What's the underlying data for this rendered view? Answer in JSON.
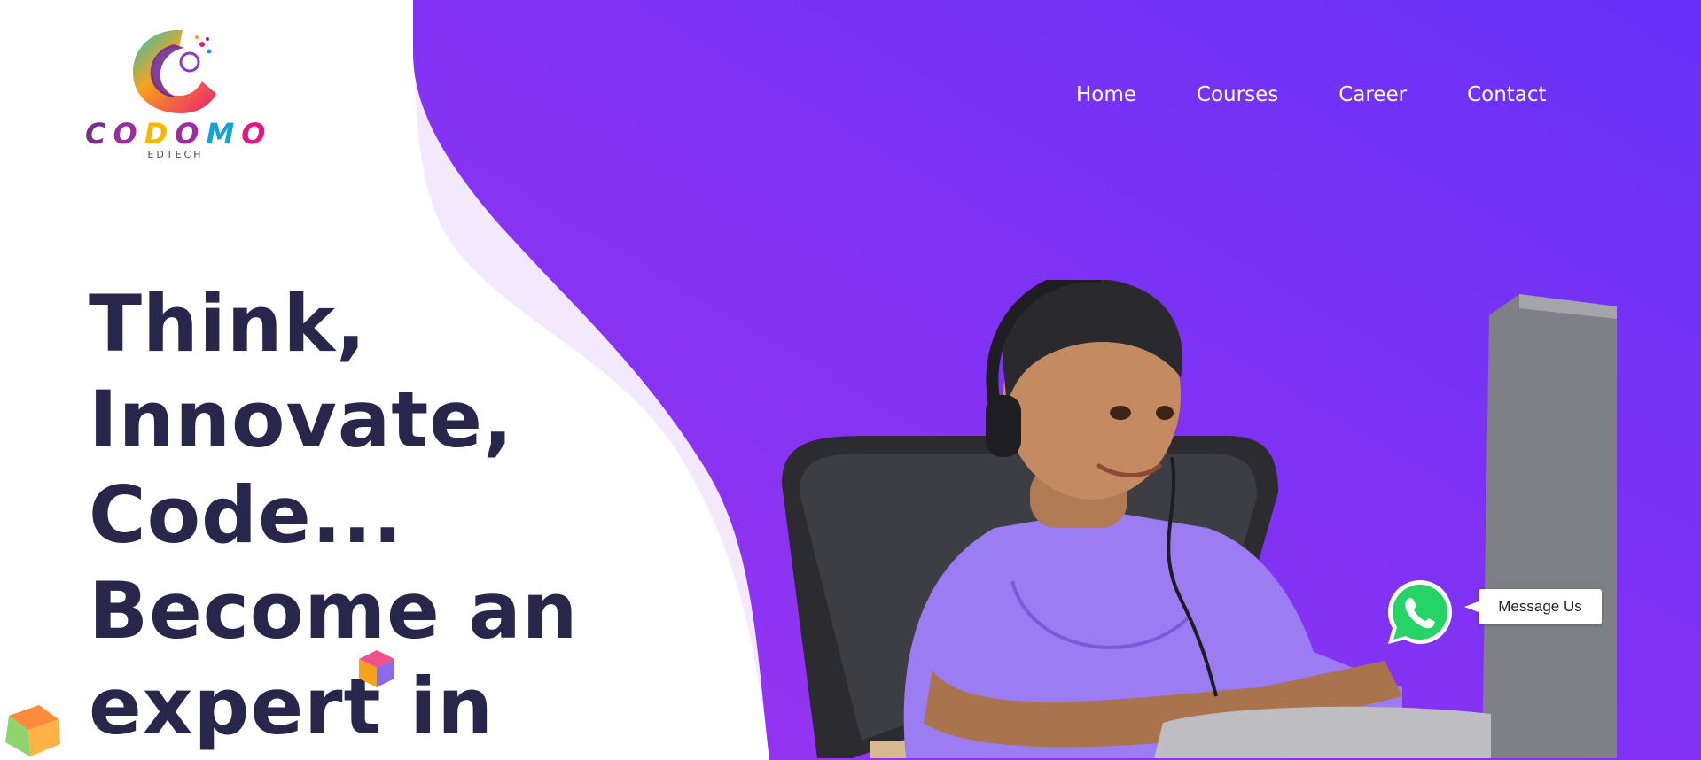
{
  "brand": {
    "name_letters": [
      "C",
      "O",
      "D",
      "O",
      "M",
      "O"
    ],
    "name_colors": [
      "#7b2d8e",
      "#9a2ea0",
      "#f5b800",
      "#a12aa0",
      "#1aa0d8",
      "#e6167e"
    ],
    "tagline": "EDTECH"
  },
  "nav": {
    "items": [
      "Home",
      "Courses",
      "Career",
      "Contact"
    ]
  },
  "hero": {
    "lines": [
      "Think,",
      "Innovate,",
      "Code...",
      "Become an",
      "expert in"
    ]
  },
  "whatsapp": {
    "icon": "whatsapp-icon",
    "label": "Message Us"
  },
  "colors": {
    "purple_start": "#9333ea",
    "purple_end": "#6a2ff8",
    "heading": "#29264b",
    "whatsapp_green": "#25d366"
  }
}
